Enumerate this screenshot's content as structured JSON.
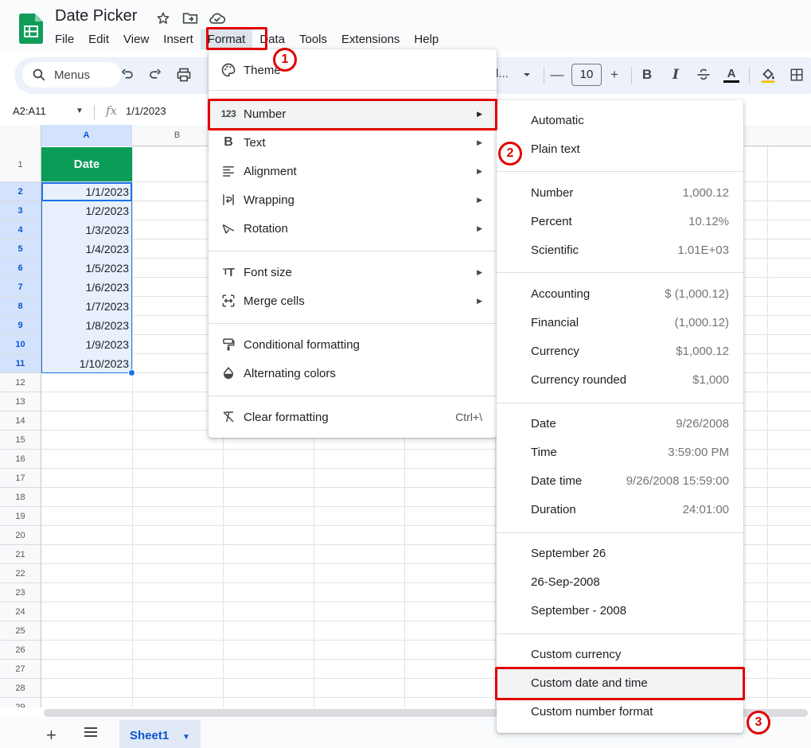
{
  "app": {
    "title": "Date Picker",
    "menus": [
      "File",
      "Edit",
      "View",
      "Insert",
      "Format",
      "Data",
      "Tools",
      "Extensions",
      "Help"
    ],
    "active_menu": "Format"
  },
  "toolbar": {
    "search_label": "Menus",
    "font_partial": "l...",
    "font_size": "10",
    "minus": "—",
    "plus": "+",
    "bold": "B",
    "italic": "I",
    "text_color": "A"
  },
  "formula_bar": {
    "name_box": "A2:A11",
    "fx": "fx",
    "formula": "1/1/2023"
  },
  "grid": {
    "columns": [
      "A",
      "B"
    ],
    "header_cell": "Date",
    "rows": [
      "1",
      "2",
      "3",
      "4",
      "5",
      "6",
      "7",
      "8",
      "9",
      "10",
      "11",
      "12",
      "13",
      "14",
      "15",
      "16",
      "17",
      "18",
      "19",
      "20",
      "21",
      "22",
      "23",
      "24",
      "25",
      "26",
      "27",
      "28",
      "29"
    ],
    "dates": [
      "1/1/2023",
      "1/2/2023",
      "1/3/2023",
      "1/4/2023",
      "1/5/2023",
      "1/6/2023",
      "1/7/2023",
      "1/8/2023",
      "1/9/2023",
      "1/10/2023"
    ]
  },
  "sheets": {
    "add": "+",
    "tab": "Sheet1"
  },
  "format_menu": {
    "theme": "Theme",
    "number": "Number",
    "text": "Text",
    "alignment": "Alignment",
    "wrapping": "Wrapping",
    "rotation": "Rotation",
    "font_size": "Font size",
    "merge_cells": "Merge cells",
    "conditional_formatting": "Conditional formatting",
    "alternating_colors": "Alternating colors",
    "clear_formatting": "Clear formatting",
    "clear_shortcut": "Ctrl+\\",
    "number_icon": "123"
  },
  "number_menu": {
    "automatic": "Automatic",
    "plain_text": "Plain text",
    "number": {
      "label": "Number",
      "example": "1,000.12"
    },
    "percent": {
      "label": "Percent",
      "example": "10.12%"
    },
    "scientific": {
      "label": "Scientific",
      "example": "1.01E+03"
    },
    "accounting": {
      "label": "Accounting",
      "example": "$ (1,000.12)"
    },
    "financial": {
      "label": "Financial",
      "example": "(1,000.12)"
    },
    "currency": {
      "label": "Currency",
      "example": "$1,000.12"
    },
    "currency_rounded": {
      "label": "Currency rounded",
      "example": "$1,000"
    },
    "date": {
      "label": "Date",
      "example": "9/26/2008"
    },
    "time": {
      "label": "Time",
      "example": "3:59:00 PM"
    },
    "date_time": {
      "label": "Date time",
      "example": "9/26/2008 15:59:00"
    },
    "duration": {
      "label": "Duration",
      "example": "24:01:00"
    },
    "september_26": "September 26",
    "sep_2008": "26-Sep-2008",
    "september_2008": "September - 2008",
    "custom_currency": "Custom currency",
    "custom_date_time": "Custom date and time",
    "custom_number": "Custom number format"
  },
  "annotations": {
    "step1": "1",
    "step2": "2",
    "step3": "3",
    "color": "#e00000"
  },
  "colors": {
    "header_green": "#0a9d58",
    "selection_blue": "#1a73e8",
    "selection_fill": "#e8f0fe"
  }
}
